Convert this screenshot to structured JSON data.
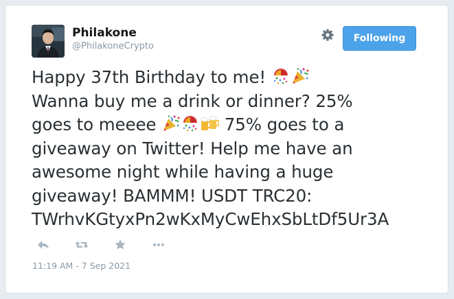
{
  "user": {
    "display_name": "Philakone",
    "handle": "@PhilakoneCrypto"
  },
  "follow_button": {
    "label": "Following"
  },
  "tweet": {
    "lines": [
      {
        "before": "Happy 37th Birthday to me! ",
        "emojis": [
          "confetti-ball",
          "party-popper"
        ],
        "after": ""
      },
      {
        "before": "Wanna buy me a drink or dinner? 25%",
        "emojis": [],
        "after": ""
      },
      {
        "before": "goes to meeee ",
        "emojis": [
          "party-popper",
          "confetti-ball",
          "beer-mugs"
        ],
        "after": " 75% goes to a"
      },
      {
        "before": "giveaway on Twitter! Help me have an",
        "emojis": [],
        "after": ""
      },
      {
        "before": "awesome night while having a huge",
        "emojis": [],
        "after": ""
      },
      {
        "before": "giveaway! BAMMM! USDT TRC20:",
        "emojis": [],
        "after": ""
      },
      {
        "before": "TWrhvKGtyxPn2wKxMyCwEhxSbLtDf5Ur3A",
        "emojis": [],
        "after": ""
      }
    ],
    "timestamp": "11:19 AM - 7 Sep 2021"
  },
  "actions": [
    "reply-icon",
    "retweet-icon",
    "favorite-icon",
    "more-icon"
  ],
  "colors": {
    "accent": "#4da3e9",
    "text": "#292f33",
    "muted": "#8899a6",
    "icon": "#a8b6c1"
  }
}
